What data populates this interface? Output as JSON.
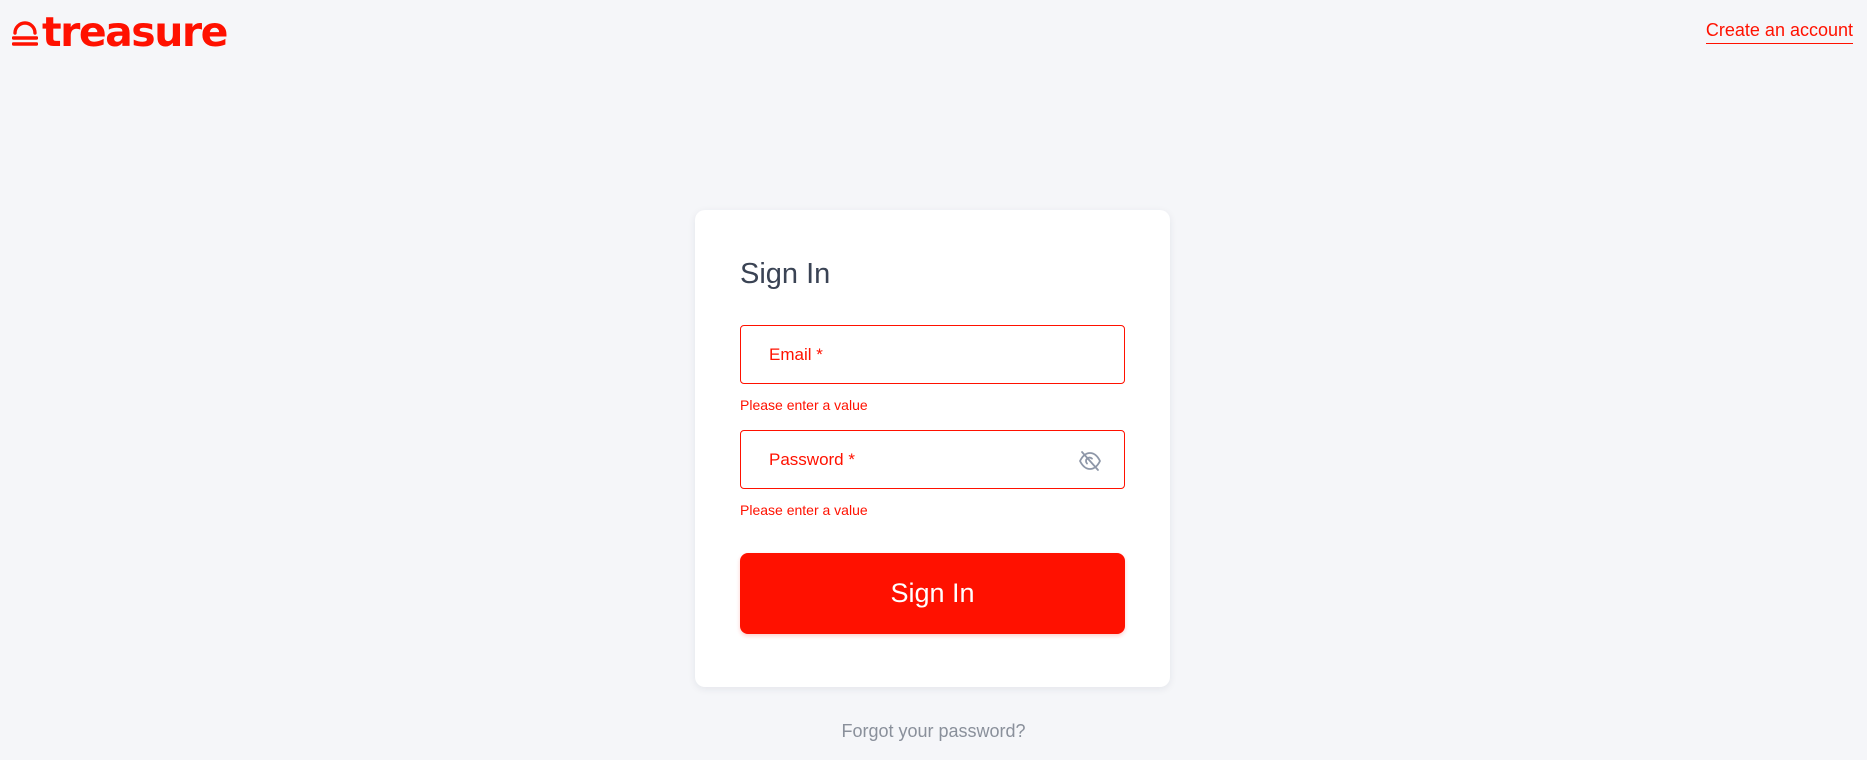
{
  "header": {
    "logo_text": "treasure",
    "create_account_label": "Create an account"
  },
  "signin_card": {
    "title": "Sign In",
    "email": {
      "label": "Email *",
      "value": "",
      "error": "Please enter a value"
    },
    "password": {
      "label": "Password *",
      "value": "",
      "error": "Please enter a value",
      "visibility_icon": "eye-off-icon"
    },
    "submit_label": "Sign In"
  },
  "forgot_password_label": "Forgot your password?",
  "colors": {
    "brand": "#ff1100",
    "background": "#f5f6f9",
    "card": "#ffffff",
    "title_text": "#3a4354",
    "muted_text": "#8a909b",
    "icon": "#8e97a8"
  }
}
